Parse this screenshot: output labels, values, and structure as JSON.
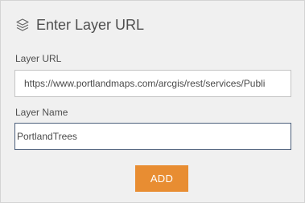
{
  "dialog": {
    "title": "Enter Layer URL",
    "icon": "layers-icon"
  },
  "fields": {
    "url": {
      "label": "Layer URL",
      "value": "https://www.portlandmaps.com/arcgis/rest/services/Publi"
    },
    "name": {
      "label": "Layer Name",
      "value": "PortlandTrees"
    }
  },
  "actions": {
    "add_label": "ADD"
  },
  "colors": {
    "accent": "#e88d32",
    "panel_bg": "#f0f0f0",
    "focus_border": "#4b5e7a"
  }
}
